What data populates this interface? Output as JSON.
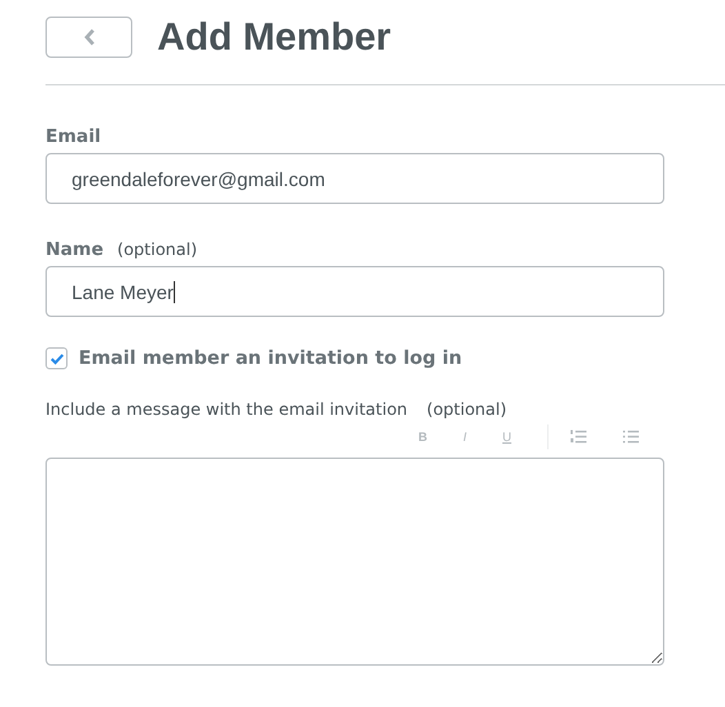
{
  "header": {
    "title": "Add Member"
  },
  "email": {
    "label": "Email",
    "value": "greendaleforever@gmail.com"
  },
  "name": {
    "label": "Name",
    "hint": "(optional)",
    "value": "Lane Meyer"
  },
  "invite": {
    "label": "Email member an invitation to log in",
    "checked": true
  },
  "message": {
    "label": "Include a message with the email invitation",
    "hint": "(optional)"
  },
  "toolbar": [
    {
      "kind": "bold",
      "text": "B"
    },
    {
      "kind": "italic",
      "text": "I"
    },
    {
      "kind": "underline",
      "text": "U"
    },
    {
      "kind": "numbered-list"
    },
    {
      "kind": "bullet-list"
    }
  ]
}
